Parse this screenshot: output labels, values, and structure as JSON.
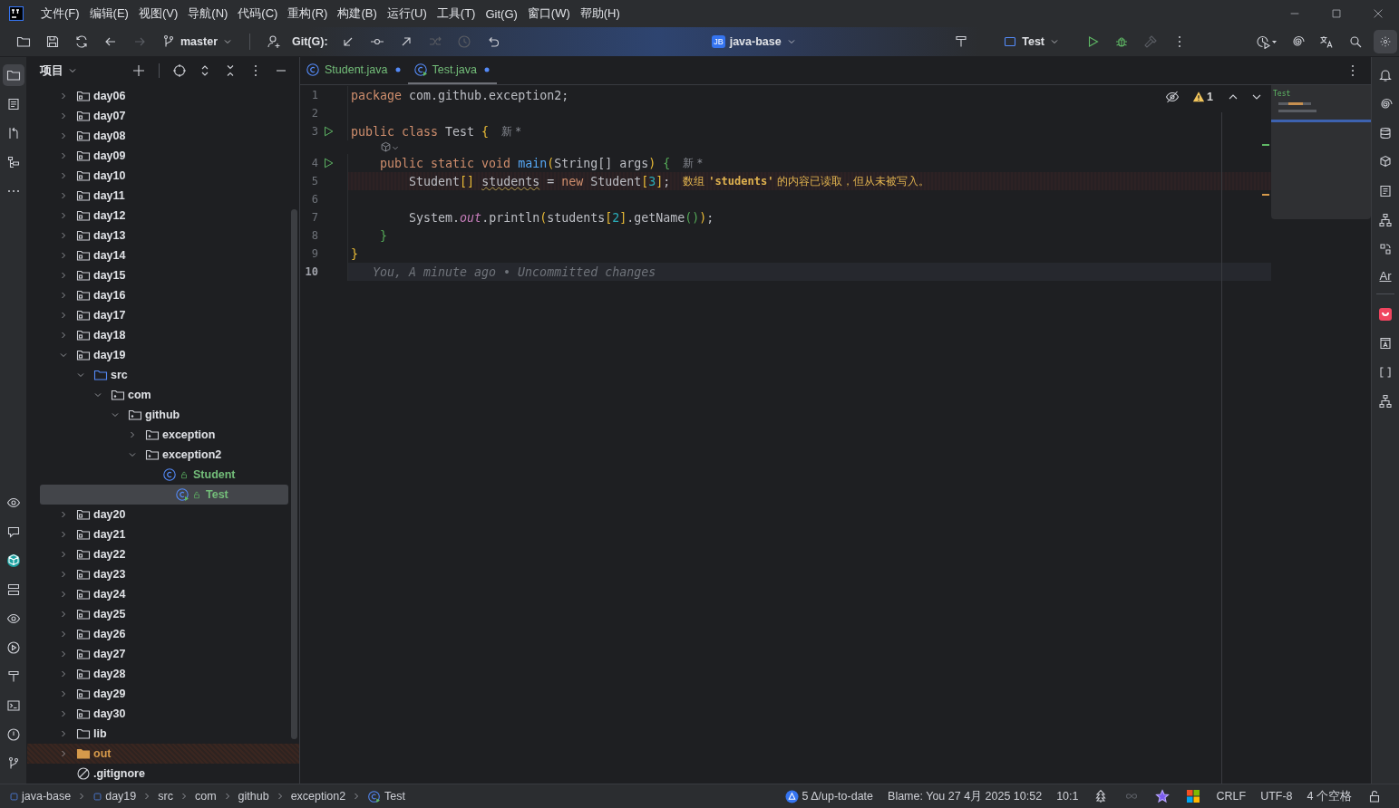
{
  "title_bar": {
    "menus": [
      "文件(F)",
      "编辑(E)",
      "视图(V)",
      "导航(N)",
      "代码(C)",
      "重构(R)",
      "构建(B)",
      "运行(U)",
      "工具(T)",
      "Git(G)",
      "窗口(W)",
      "帮助(H)"
    ]
  },
  "toolbar": {
    "nav_actions": [
      {
        "disabled": false
      },
      {
        "disabled": false
      },
      {
        "disabled": false
      },
      {
        "disabled": false
      },
      {
        "disabled": true
      }
    ],
    "branch": "master",
    "vcs_label": "Git(G):",
    "vcs_actions": [
      {
        "disabled": false
      },
      {
        "disabled": false
      },
      {
        "disabled": false
      },
      {
        "disabled": true
      },
      {
        "disabled": true
      },
      {
        "disabled": false
      }
    ],
    "project_badge": "JB",
    "project": "java-base",
    "run_config": "Test",
    "run_actions": [
      {
        "disabled": false
      },
      {
        "disabled": false
      },
      {
        "disabled": true
      }
    ],
    "settings": {
      "selected": true
    }
  },
  "left_strip": {
    "top": [
      {
        "selected": true
      },
      {
        "selected": false
      },
      {
        "selected": false
      },
      {
        "selected": false
      },
      {
        "selected": false
      }
    ]
  },
  "project": {
    "title": "项目",
    "tree": [
      {
        "name": "day06",
        "kind": "module",
        "expanded": false,
        "selected": false
      },
      {
        "name": "day07",
        "kind": "module",
        "expanded": false,
        "selected": false
      },
      {
        "name": "day08",
        "kind": "module",
        "expanded": false,
        "selected": false
      },
      {
        "name": "day09",
        "kind": "module",
        "expanded": false,
        "selected": false
      },
      {
        "name": "day10",
        "kind": "module",
        "expanded": false,
        "selected": false
      },
      {
        "name": "day11",
        "kind": "module",
        "expanded": false,
        "selected": false
      },
      {
        "name": "day12",
        "kind": "module",
        "expanded": false,
        "selected": false
      },
      {
        "name": "day13",
        "kind": "module",
        "expanded": false,
        "selected": false
      },
      {
        "name": "day14",
        "kind": "module",
        "expanded": false,
        "selected": false
      },
      {
        "name": "day15",
        "kind": "module",
        "expanded": false,
        "selected": false
      },
      {
        "name": "day16",
        "kind": "module",
        "expanded": false,
        "selected": false
      },
      {
        "name": "day17",
        "kind": "module",
        "expanded": false,
        "selected": false
      },
      {
        "name": "day18",
        "kind": "module",
        "expanded": false,
        "selected": false
      },
      {
        "name": "day19",
        "kind": "module",
        "expanded": true,
        "selected": false,
        "children": [
          {
            "name": "src",
            "kind": "source",
            "expanded": true,
            "selected": false,
            "children": [
              {
                "name": "com",
                "kind": "package",
                "expanded": true,
                "selected": false,
                "children": [
                  {
                    "name": "github",
                    "kind": "package",
                    "expanded": true,
                    "selected": false,
                    "children": [
                      {
                        "name": "exception",
                        "kind": "package",
                        "expanded": false,
                        "selected": false
                      },
                      {
                        "name": "exception2",
                        "kind": "package",
                        "expanded": true,
                        "selected": false,
                        "children": [
                          {
                            "name": "Student",
                            "kind": "class",
                            "added": true,
                            "selected": false
                          },
                          {
                            "name": "Test",
                            "kind": "main-class",
                            "added": true,
                            "selected": true
                          }
                        ]
                      }
                    ]
                  }
                ]
              }
            ]
          }
        ]
      },
      {
        "name": "day20",
        "kind": "module",
        "expanded": false,
        "selected": false
      },
      {
        "name": "day21",
        "kind": "module",
        "expanded": false,
        "selected": false
      },
      {
        "name": "day22",
        "kind": "module",
        "expanded": false,
        "selected": false
      },
      {
        "name": "day23",
        "kind": "module",
        "expanded": false,
        "selected": false
      },
      {
        "name": "day24",
        "kind": "module",
        "expanded": false,
        "selected": false
      },
      {
        "name": "day25",
        "kind": "module",
        "expanded": false,
        "selected": false
      },
      {
        "name": "day26",
        "kind": "module",
        "expanded": false,
        "selected": false
      },
      {
        "name": "day27",
        "kind": "module",
        "expanded": false,
        "selected": false
      },
      {
        "name": "day28",
        "kind": "module",
        "expanded": false,
        "selected": false
      },
      {
        "name": "day29",
        "kind": "module",
        "expanded": false,
        "selected": false
      },
      {
        "name": "day30",
        "kind": "module",
        "expanded": false,
        "selected": false
      },
      {
        "name": "lib",
        "kind": "folder",
        "expanded": false,
        "selected": false
      },
      {
        "name": "out",
        "kind": "excluded",
        "expanded": false,
        "selected": false
      },
      {
        "name": ".gitignore",
        "kind": "ignore-file",
        "selected": false
      }
    ]
  },
  "editor": {
    "tabs": [
      {
        "name": "Student.java",
        "kind": "class",
        "selected": false,
        "modified": true
      },
      {
        "name": "Test.java",
        "kind": "main-class",
        "selected": true,
        "modified": true
      }
    ],
    "inspections": {
      "warnings": "1"
    },
    "lines": [
      {
        "kind": "code",
        "number": "1",
        "tokens": [
          {
            "kind": "keyword",
            "text": "package"
          },
          {
            "kind": "plain",
            "text": " com.github.exception2;"
          }
        ]
      },
      {
        "kind": "code",
        "number": "2"
      },
      {
        "kind": "code",
        "number": "3",
        "run": true,
        "tokens": [
          {
            "kind": "keyword",
            "text": "public class "
          },
          {
            "kind": "plain",
            "text": "Test "
          },
          {
            "kind": "bracket1",
            "text": "{"
          }
        ],
        "hint": "新 *"
      },
      {
        "kind": "inlay"
      },
      {
        "kind": "code",
        "number": "4",
        "run": true,
        "tokens": [
          {
            "kind": "keyword",
            "text": "    public static void "
          },
          {
            "kind": "method",
            "text": "main"
          },
          {
            "kind": "bracket1",
            "text": "("
          },
          {
            "kind": "plain",
            "text": "String[] args"
          },
          {
            "kind": "bracket1",
            "text": ") "
          },
          {
            "kind": "bracket2",
            "text": "{"
          }
        ],
        "hint": "新 *"
      },
      {
        "kind": "code",
        "number": "5",
        "warning": true,
        "tokens": [
          {
            "kind": "plain",
            "text": "        Student"
          },
          {
            "kind": "bracket1",
            "text": "[] "
          },
          {
            "kind": "unused",
            "text": "students"
          },
          {
            "kind": "plain",
            "text": " = "
          },
          {
            "kind": "keyword",
            "text": "new "
          },
          {
            "kind": "plain",
            "text": "Student"
          },
          {
            "kind": "bracket1",
            "text": "["
          },
          {
            "kind": "number",
            "text": "3"
          },
          {
            "kind": "bracket1",
            "text": "]"
          },
          {
            "kind": "plain",
            "text": ";"
          }
        ],
        "warning_text": "数组 **'students'** 的内容已读取，但从未被写入。"
      },
      {
        "kind": "code",
        "number": "6"
      },
      {
        "kind": "code",
        "number": "7",
        "tokens": [
          {
            "kind": "plain",
            "text": "        System."
          },
          {
            "kind": "field",
            "text": "out"
          },
          {
            "kind": "plain",
            "text": ".println"
          },
          {
            "kind": "bracket1",
            "text": "("
          },
          {
            "kind": "plain",
            "text": "students"
          },
          {
            "kind": "bracket1",
            "text": "["
          },
          {
            "kind": "number",
            "text": "2"
          },
          {
            "kind": "bracket1",
            "text": "]"
          },
          {
            "kind": "plain",
            "text": ".getName"
          },
          {
            "kind": "bracket2",
            "text": "()"
          },
          {
            "kind": "bracket1",
            "text": ")"
          },
          {
            "kind": "plain",
            "text": ";"
          }
        ]
      },
      {
        "kind": "code",
        "number": "8",
        "tokens": [
          {
            "kind": "bracket2",
            "text": "    }"
          }
        ]
      },
      {
        "kind": "code",
        "number": "9",
        "tokens": [
          {
            "kind": "bracket1",
            "text": "}"
          }
        ]
      },
      {
        "kind": "code",
        "number": "10",
        "current": true,
        "blame": "You, A minute ago • Uncommitted changes"
      }
    ],
    "minimap": {
      "label": "Test"
    }
  },
  "right_strip": {
    "text_icon": "Ar"
  },
  "status_bar": {
    "breadcrumbs": [
      {
        "text": "java-base",
        "kind": "module"
      },
      {
        "text": "day19",
        "kind": "module"
      },
      {
        "text": "src",
        "kind": "folder"
      },
      {
        "text": "com",
        "kind": "folder"
      },
      {
        "text": "github",
        "kind": "folder"
      },
      {
        "text": "exception2",
        "kind": "folder"
      },
      {
        "text": "Test",
        "kind": "main-class"
      }
    ],
    "vcs": "5 Δ/up-to-date",
    "blame": "Blame: You 27 4月 2025 10:52",
    "position": "10:1",
    "line_separator": "CRLF",
    "encoding": "UTF-8",
    "indent": "4 个空格"
  }
}
